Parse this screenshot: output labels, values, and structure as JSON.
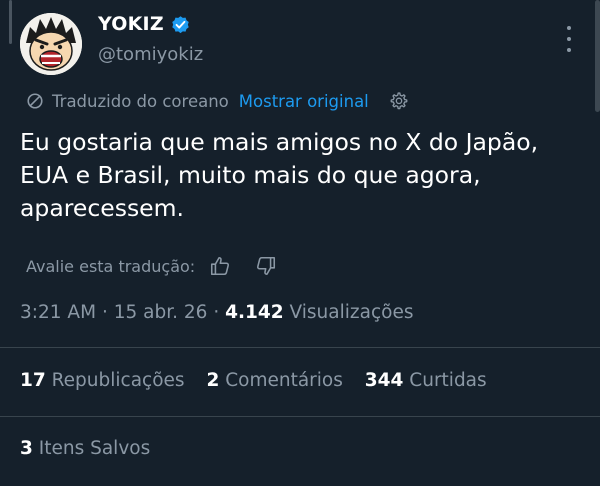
{
  "author": {
    "display_name": "YOKIZ",
    "handle": "@tomiyokiz",
    "verified": true
  },
  "translation": {
    "note": "Traduzido do coreano",
    "show_original": "Mostrar original"
  },
  "post": {
    "text": "Eu gostaria que mais amigos no X do Japão, EUA e Brasil, muito mais do que agora, aparecessem."
  },
  "rating": {
    "label": "Avalie esta tradução:"
  },
  "meta": {
    "time": "3:21 AM",
    "date": "15 abr. 26",
    "views_count": "4.142",
    "views_label": "Visualizações",
    "separator": "·"
  },
  "stats": {
    "reposts_count": "17",
    "reposts_label": "Republicações",
    "comments_count": "2",
    "comments_label": "Comentários",
    "likes_count": "344",
    "likes_label": "Curtidas",
    "saves_count": "3",
    "saves_label": "Itens Salvos"
  },
  "colors": {
    "background": "#15202b",
    "accent": "#1d9bf0",
    "secondary_text": "#8b98a5",
    "divider": "#38444d"
  },
  "icons": {
    "verified": "verified-badge-icon",
    "translate": "translate-icon",
    "settings": "gear-icon",
    "thumbs_up": "thumbs-up-icon",
    "thumbs_down": "thumbs-down-icon",
    "more": "more-vertical-icon"
  }
}
